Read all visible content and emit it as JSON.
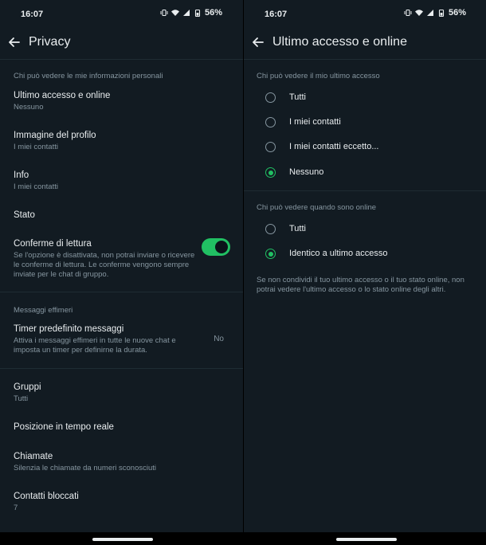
{
  "status_bar": {
    "time": "16:07",
    "battery": "56%"
  },
  "left": {
    "title": "Privacy",
    "section_personal": "Chi può vedere le mie informazioni personali",
    "items": [
      {
        "title": "Ultimo accesso e online",
        "subtitle": "Nessuno"
      },
      {
        "title": "Immagine del profilo",
        "subtitle": "I miei contatti"
      },
      {
        "title": "Info",
        "subtitle": "I miei contatti"
      },
      {
        "title": "Stato",
        "subtitle": ""
      }
    ],
    "read_receipts": {
      "title": "Conferme di lettura",
      "desc": "Se l'opzione è disattivata, non potrai inviare o ricevere le conferme di lettura. Le conferme vengono sempre inviate per le chat di gruppo.",
      "enabled": true
    },
    "section_ephemeral": "Messaggi effimeri",
    "timer": {
      "title": "Timer predefinito messaggi",
      "desc": "Attiva i messaggi effimeri in tutte le nuove chat e imposta un timer per definirne la durata.",
      "value": "No"
    },
    "items2": [
      {
        "title": "Gruppi",
        "subtitle": "Tutti"
      },
      {
        "title": "Posizione in tempo reale",
        "subtitle": ""
      },
      {
        "title": "Chiamate",
        "subtitle": "Silenzia le chiamate da numeri sconosciuti"
      },
      {
        "title": "Contatti bloccati",
        "subtitle": "7"
      }
    ]
  },
  "right": {
    "title": "Ultimo accesso e online",
    "last_seen": {
      "header": "Chi può vedere il mio ultimo accesso",
      "options": [
        "Tutti",
        "I miei contatti",
        "I miei contatti eccetto...",
        "Nessuno"
      ],
      "selected": 3
    },
    "online": {
      "header": "Chi può vedere quando sono online",
      "options": [
        "Tutti",
        "Identico a ultimo accesso"
      ],
      "selected": 1
    },
    "note": "Se non condividi il tuo ultimo accesso o il tuo stato online, non potrai vedere l'ultimo accesso o lo stato online degli altri."
  },
  "colors": {
    "background": "#121b22",
    "accent": "#21c063",
    "secondary_text": "#8696a0",
    "primary_text": "#e9edef"
  }
}
